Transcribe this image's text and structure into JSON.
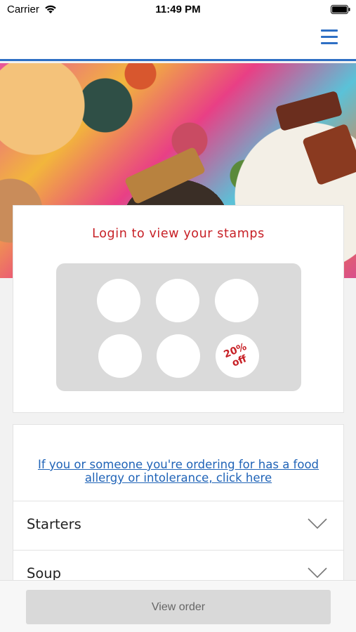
{
  "status_bar": {
    "carrier": "Carrier",
    "time": "11:49 PM",
    "icons": [
      "wifi-icon",
      "battery-icon"
    ]
  },
  "header": {
    "menu_icon": "hamburger-menu-icon",
    "accent_color": "#2e6fc4"
  },
  "hero": {
    "image": "mexican-food-spread-photo"
  },
  "stamps": {
    "title": "Login to view your stamps",
    "stamp_count": 6,
    "reward_label": "20%\noff",
    "title_color": "#c72026"
  },
  "menu": {
    "allergy_link": "If you or someone you're ordering for has a food allergy or intolerance, click here",
    "categories": [
      {
        "label": "Starters"
      },
      {
        "label": "Soup"
      }
    ],
    "chevron_icon": "chevron-down-icon"
  },
  "footer": {
    "view_order_label": "View order"
  }
}
